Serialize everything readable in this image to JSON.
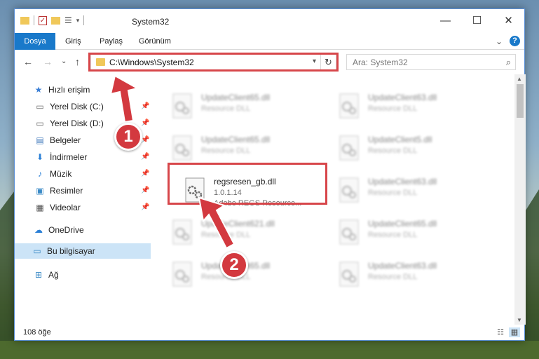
{
  "window": {
    "title": "System32",
    "minimize": "—",
    "maximize": "☐",
    "close": "✕"
  },
  "ribbon": {
    "tabs": [
      "Dosya",
      "Giriş",
      "Paylaş",
      "Görünüm"
    ],
    "expand": "⌄",
    "help": "?"
  },
  "nav": {
    "back": "←",
    "forward": "→",
    "recent": "⌄",
    "up": "↑",
    "address": "C:\\Windows\\System32",
    "refresh": "↻",
    "search_placeholder": "Ara: System32"
  },
  "sidebar": {
    "items": [
      {
        "label": "Hızlı erişim",
        "icon": "star-icon"
      },
      {
        "label": "Yerel Disk (C:)",
        "icon": "drive-icon",
        "pinned": true
      },
      {
        "label": "Yerel Disk (D:)",
        "icon": "drive-icon",
        "pinned": true
      },
      {
        "label": "Belgeler",
        "icon": "document-icon",
        "pinned": true
      },
      {
        "label": "İndirmeler",
        "icon": "download-icon",
        "pinned": true
      },
      {
        "label": "Müzik",
        "icon": "music-icon",
        "pinned": true
      },
      {
        "label": "Resimler",
        "icon": "pictures-icon",
        "pinned": true
      },
      {
        "label": "Videolar",
        "icon": "video-icon",
        "pinned": true
      },
      {
        "label": "OneDrive",
        "icon": "cloud-icon"
      },
      {
        "label": "Bu bilgisayar",
        "icon": "computer-icon",
        "selected": true
      },
      {
        "label": "Ağ",
        "icon": "network-icon"
      }
    ]
  },
  "files": [
    {
      "name": "UpdateClient65.dll",
      "line2": "Resource DLL",
      "line3": ""
    },
    {
      "name": "UpdateClient63.dll",
      "line2": "Resource DLL",
      "line3": ""
    },
    {
      "name": "UpdateClient65.dll",
      "line2": "Resource DLL",
      "line3": ""
    },
    {
      "name": "UpdateClient5.dll",
      "line2": "Resource DLL",
      "line3": ""
    },
    {
      "name": "regsresen_gb.dll",
      "line2": "1.0.1.14",
      "line3": "Adobe REGS Resource..."
    },
    {
      "name": "UpdateClient63.dll",
      "line2": "Resource DLL",
      "line3": ""
    },
    {
      "name": "UpdateClient621.dll",
      "line2": "Resource DLL",
      "line3": ""
    },
    {
      "name": "UpdateClient65.dll",
      "line2": "Resource DLL",
      "line3": ""
    },
    {
      "name": "UpdateClient65.dll",
      "line2": "Resource DLL",
      "line3": ""
    },
    {
      "name": "UpdateClient63.dll",
      "line2": "Resource DLL",
      "line3": ""
    }
  ],
  "status": {
    "count": "108 öğe"
  },
  "annotations": {
    "step1": "1",
    "step2": "2",
    "color": "#d7464a"
  }
}
